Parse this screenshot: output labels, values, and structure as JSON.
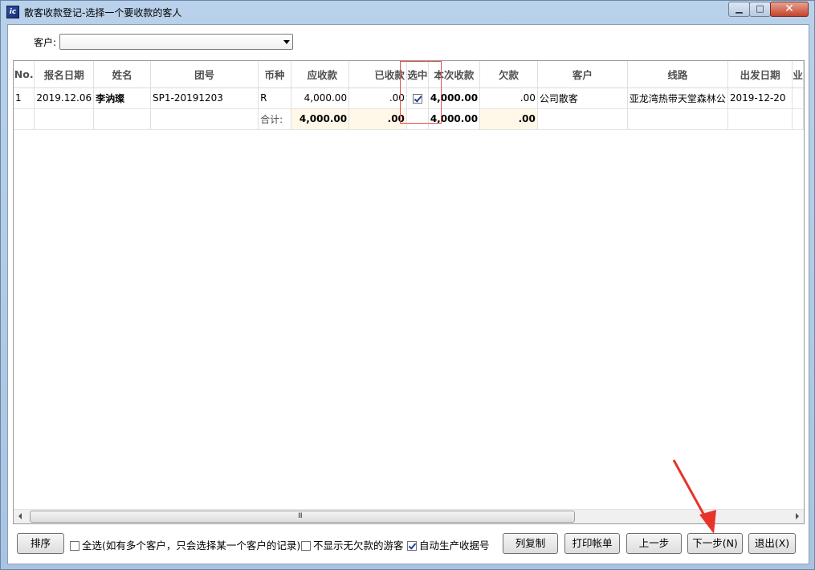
{
  "window": {
    "title": "散客收款登记-选择一个要收款的客人",
    "icon": "app-icon",
    "app_icon_label": "ic"
  },
  "filter": {
    "customer_label": "客户:",
    "customer_value": ""
  },
  "table": {
    "columns": [
      "No.",
      "报名日期",
      "姓名",
      "团号",
      "币种",
      "应收款",
      "已收款",
      "选中",
      "本次收款",
      "欠款",
      "客户",
      "线路",
      "出发日期",
      "业"
    ],
    "rows": [
      {
        "no": "1",
        "reg_date": "2019.12.06",
        "name": "李汭璨",
        "group_no": "SP1-20191203",
        "currency": "R",
        "receivable": "4,000.00",
        "received": ".00",
        "selected": true,
        "this_payment": "4,000.00",
        "owed": ".00",
        "customer": "公司散客",
        "route": "亚龙湾热带天堂森林公",
        "depart_date": "2019-12-20"
      }
    ],
    "totals": {
      "label": "合计:",
      "receivable": "4,000.00",
      "received": ".00",
      "this_payment": "4,000.00",
      "owed": ".00"
    }
  },
  "scrollbar": {
    "grip": "III"
  },
  "bottom": {
    "sort_button": "排序",
    "select_all_label": "全选(如有多个客户，只会选择某一个客户的记录)",
    "select_all_checked": false,
    "hide_no_debt_label": "不显示无欠款的游客",
    "hide_no_debt_checked": false,
    "auto_receipt_label": "自动生产收据号",
    "auto_receipt_checked": true,
    "copy_columns_button": "列复制",
    "print_button": "打印帐单",
    "prev_button": "上一步",
    "next_button": "下一步(N)",
    "exit_button": "退出(X)"
  },
  "colors": {
    "highlight_box": "#e0524a",
    "arrow": "#e8332a",
    "window_frame": "#b9d1ea"
  }
}
